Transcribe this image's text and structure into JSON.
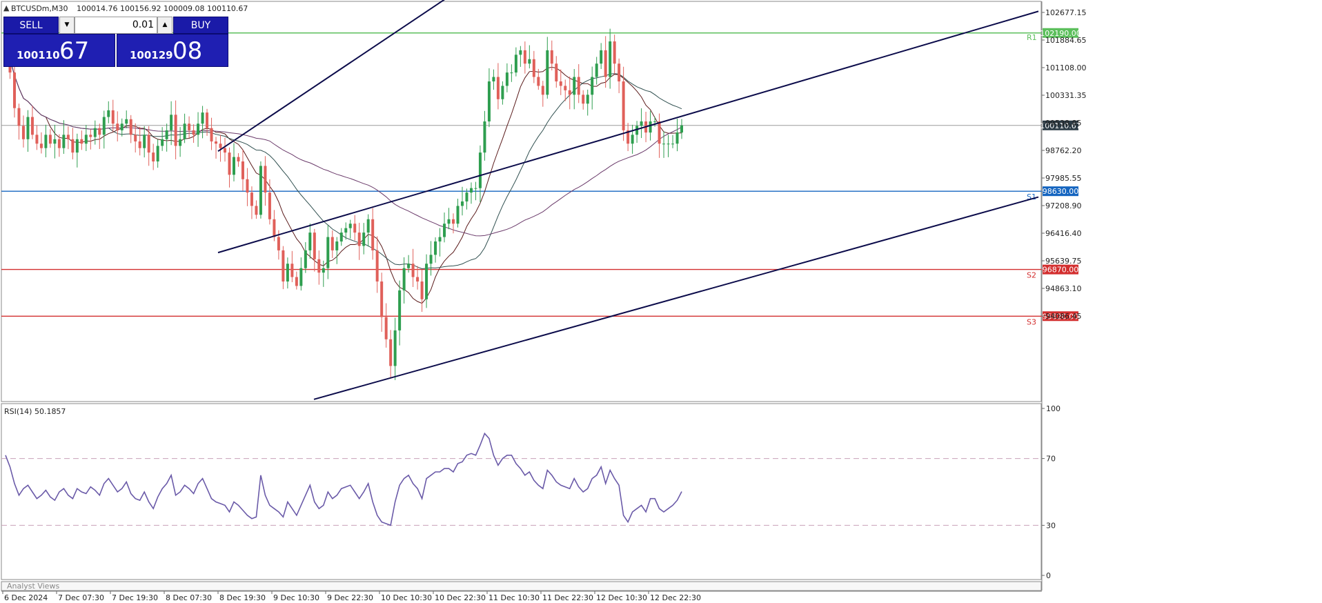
{
  "header": {
    "symbol": "BTCUSDm,M30",
    "ohlc": "100014.76 100156.92 100009.08 100110.67"
  },
  "trade_panel": {
    "sell_label": "SELL",
    "buy_label": "BUY",
    "lot_value": "0.01",
    "sell_price_small": "100110",
    "sell_price_big": "67",
    "buy_price_small": "100129",
    "buy_price_big": "08"
  },
  "colors": {
    "bull": "#2e9e4f",
    "bear": "#e0605a",
    "channel": "#0b0b4a",
    "resistance": "#5cbf5c",
    "support_blue": "#1565c0",
    "support_red": "#d32f2f",
    "rsi": "#6a5aa8",
    "current_price_label_bg": "#2b3a44"
  },
  "footer_panel_label": "Analyst Views",
  "chart_data": [
    {
      "type": "candlestick",
      "name": "price",
      "y_axis_ticks": [
        "102677.15",
        "101884.65",
        "101108.00",
        "100331.35",
        "99538.85",
        "98762.20",
        "97985.55",
        "97208.90",
        "96416.40",
        "95639.75",
        "94863.10",
        "94086.45"
      ],
      "x_axis_ticks": [
        "6 Dec 2024",
        "7 Dec 07:30",
        "7 Dec 19:30",
        "8 Dec 07:30",
        "8 Dec 19:30",
        "9 Dec 10:30",
        "9 Dec 22:30",
        "10 Dec 10:30",
        "10 Dec 22:30",
        "11 Dec 10:30",
        "11 Dec 22:30",
        "12 Dec 10:30",
        "12 Dec 22:30"
      ],
      "ylim": [
        93900,
        102900
      ],
      "levels": [
        {
          "price": 102190.0,
          "label": "102190.00",
          "tag": "R1",
          "color": "#5cbf5c"
        },
        {
          "price": 98630.0,
          "label": "98630.00",
          "tag": "S1",
          "color": "#1565c0"
        },
        {
          "price": 96870.0,
          "label": "96870.00",
          "tag": "S2",
          "color": "#d32f2f"
        },
        {
          "price": 95820.0,
          "label": "95820.00",
          "tag": "S3",
          "color": "#d32f2f"
        }
      ],
      "current_price": {
        "price": 100110.67,
        "label": "100110.67"
      },
      "series_close": [
        101900,
        101300,
        100500,
        100100,
        99800,
        100300,
        99900,
        99700,
        99600,
        99900,
        99700,
        99800,
        99600,
        99900,
        99800,
        99500,
        99800,
        99700,
        99900,
        99850,
        100050,
        99900,
        100300,
        100450,
        100150,
        100000,
        100150,
        100250,
        99900,
        99750,
        99600,
        99900,
        99500,
        99300,
        99650,
        99800,
        100000,
        100350,
        99650,
        99800,
        100150,
        100000,
        99900,
        100150,
        100400,
        100050,
        99750,
        99700,
        99600,
        99500,
        99000,
        99400,
        99300,
        98900,
        98600,
        98300,
        98100,
        99200,
        98600,
        98000,
        97600,
        97300,
        96600,
        97000,
        96700,
        96500,
        96900,
        97300,
        97700,
        97100,
        96800,
        96900,
        97600,
        97300,
        97500,
        97700,
        97800,
        97900,
        97700,
        97400,
        97700,
        98000,
        97300,
        96600,
        95800,
        95300,
        94700,
        95500,
        96400,
        96900,
        97000,
        96700,
        96600,
        96200,
        97000,
        97200,
        97500,
        97600,
        97900,
        98000,
        97900,
        98300,
        98400,
        98600,
        98700,
        98700,
        99500,
        100200,
        101100,
        101200,
        100700,
        101000,
        101300,
        101300,
        101700,
        101800,
        101500,
        101600,
        101200,
        101000,
        100800,
        101800,
        101500,
        101100,
        101000,
        100900,
        100800,
        101200,
        100800,
        100600,
        100800,
        101200,
        101500,
        101800,
        101200,
        102000,
        101500,
        101100,
        100000,
        99700,
        99900,
        100100,
        100200,
        99950,
        100200,
        100200,
        99700,
        99700,
        99700,
        99700,
        99950,
        100110.67
      ],
      "channel_lines": [
        {
          "from": [
            "8 Dec 19:30",
            99530
          ],
          "to": [
            "10 Dec 02:30",
            102950
          ]
        },
        {
          "from": [
            "8 Dec 19:30",
            97250
          ],
          "to": [
            "13 Dec 13:30",
            102677
          ]
        },
        {
          "from": [
            "9 Dec 20:00",
            93950
          ],
          "to": [
            "13 Dec 13:30",
            98500
          ]
        }
      ]
    },
    {
      "type": "line",
      "name": "RSI(14)",
      "label": "RSI(14) 50.1857",
      "ylim": [
        0,
        100
      ],
      "y_axis_ticks": [
        "100",
        "70",
        "30",
        "0"
      ],
      "levels": [
        70,
        30
      ],
      "values": [
        72,
        65,
        55,
        48,
        52,
        54,
        50,
        46,
        48,
        51,
        47,
        45,
        50,
        52,
        48,
        46,
        52,
        50,
        49,
        53,
        51,
        48,
        55,
        58,
        54,
        50,
        52,
        56,
        49,
        46,
        45,
        50,
        44,
        40,
        47,
        52,
        55,
        60,
        48,
        50,
        54,
        52,
        49,
        55,
        58,
        52,
        46,
        44,
        43,
        42,
        38,
        44,
        42,
        39,
        36,
        34,
        35,
        60,
        48,
        42,
        40,
        38,
        35,
        44,
        40,
        36,
        42,
        48,
        54,
        44,
        40,
        42,
        50,
        46,
        48,
        52,
        53,
        54,
        50,
        46,
        50,
        55,
        44,
        36,
        32,
        31,
        30,
        44,
        54,
        58,
        60,
        55,
        52,
        46,
        58,
        60,
        62,
        62,
        64,
        64,
        62,
        67,
        68,
        72,
        73,
        72,
        78,
        85,
        82,
        72,
        66,
        70,
        72,
        72,
        67,
        64,
        60,
        62,
        57,
        54,
        52,
        63,
        60,
        56,
        54,
        53,
        52,
        58,
        53,
        50,
        52,
        58,
        60,
        65,
        55,
        63,
        58,
        54,
        36,
        32,
        38,
        40,
        42,
        38,
        46,
        46,
        40,
        38,
        40,
        42,
        45,
        50.19
      ]
    }
  ]
}
